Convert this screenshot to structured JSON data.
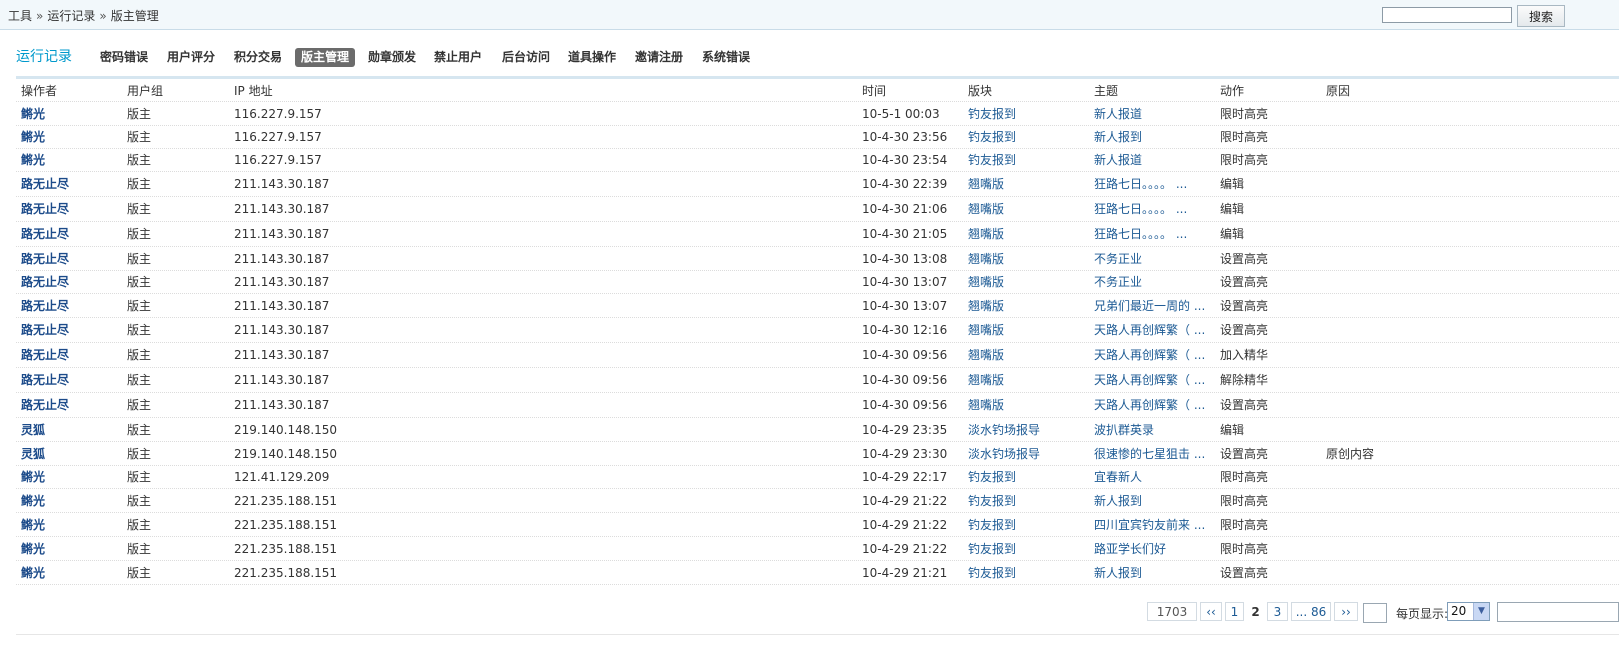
{
  "breadcrumb": {
    "items": [
      "工具",
      "运行记录",
      "版主管理"
    ],
    "separator": "»"
  },
  "search": {
    "value": "",
    "button_label": "搜索"
  },
  "tabs": {
    "title": "运行记录",
    "items": [
      {
        "label": "密码错误",
        "active": false
      },
      {
        "label": "用户评分",
        "active": false
      },
      {
        "label": "积分交易",
        "active": false
      },
      {
        "label": "版主管理",
        "active": true
      },
      {
        "label": "勋章颁发",
        "active": false
      },
      {
        "label": "禁止用户",
        "active": false
      },
      {
        "label": "后台访问",
        "active": false
      },
      {
        "label": "道具操作",
        "active": false
      },
      {
        "label": "邀请注册",
        "active": false
      },
      {
        "label": "系统错误",
        "active": false
      }
    ]
  },
  "table": {
    "headers": {
      "operator": "操作者",
      "group": "用户组",
      "ip": "IP 地址",
      "time": "时间",
      "forum": "版块",
      "subject": "主题",
      "action": "动作",
      "reason": "原因"
    },
    "rows": [
      {
        "operator": "鳉光",
        "group": "版主",
        "ip": "116.227.9.157",
        "time": "10-5-1 00:03",
        "forum": "钓友报到",
        "subject": "新人报道",
        "action": "限时高亮",
        "reason": ""
      },
      {
        "operator": "鳉光",
        "group": "版主",
        "ip": "116.227.9.157",
        "time": "10-4-30 23:56",
        "forum": "钓友报到",
        "subject": "新人报到",
        "action": "限时高亮",
        "reason": ""
      },
      {
        "operator": "鳉光",
        "group": "版主",
        "ip": "116.227.9.157",
        "time": "10-4-30 23:54",
        "forum": "钓友报到",
        "subject": "新人报道",
        "action": "限时高亮",
        "reason": ""
      },
      {
        "operator": "路无止尽",
        "group": "版主",
        "ip": "211.143.30.187",
        "time": "10-4-30 22:39",
        "forum": "翘嘴版",
        "subject": "狂路七日。。。。 ...",
        "action": "编辑",
        "reason": ""
      },
      {
        "operator": "路无止尽",
        "group": "版主",
        "ip": "211.143.30.187",
        "time": "10-4-30 21:06",
        "forum": "翘嘴版",
        "subject": "狂路七日。。。。 ...",
        "action": "编辑",
        "reason": ""
      },
      {
        "operator": "路无止尽",
        "group": "版主",
        "ip": "211.143.30.187",
        "time": "10-4-30 21:05",
        "forum": "翘嘴版",
        "subject": "狂路七日。。。。 ...",
        "action": "编辑",
        "reason": ""
      },
      {
        "operator": "路无止尽",
        "group": "版主",
        "ip": "211.143.30.187",
        "time": "10-4-30 13:08",
        "forum": "翘嘴版",
        "subject": "不务正业",
        "action": "设置高亮",
        "reason": ""
      },
      {
        "operator": "路无止尽",
        "group": "版主",
        "ip": "211.143.30.187",
        "time": "10-4-30 13:07",
        "forum": "翘嘴版",
        "subject": "不务正业",
        "action": "设置高亮",
        "reason": ""
      },
      {
        "operator": "路无止尽",
        "group": "版主",
        "ip": "211.143.30.187",
        "time": "10-4-30 13:07",
        "forum": "翘嘴版",
        "subject": "兄弟们最近一周的 ...",
        "action": "设置高亮",
        "reason": ""
      },
      {
        "operator": "路无止尽",
        "group": "版主",
        "ip": "211.143.30.187",
        "time": "10-4-30 12:16",
        "forum": "翘嘴版",
        "subject": "天路人再创辉繁（ ...",
        "action": "设置高亮",
        "reason": ""
      },
      {
        "operator": "路无止尽",
        "group": "版主",
        "ip": "211.143.30.187",
        "time": "10-4-30 09:56",
        "forum": "翘嘴版",
        "subject": "天路人再创辉繁（ ...",
        "action": "加入精华",
        "reason": ""
      },
      {
        "operator": "路无止尽",
        "group": "版主",
        "ip": "211.143.30.187",
        "time": "10-4-30 09:56",
        "forum": "翘嘴版",
        "subject": "天路人再创辉繁（ ...",
        "action": "解除精华",
        "reason": ""
      },
      {
        "operator": "路无止尽",
        "group": "版主",
        "ip": "211.143.30.187",
        "time": "10-4-30 09:56",
        "forum": "翘嘴版",
        "subject": "天路人再创辉繁（ ...",
        "action": "设置高亮",
        "reason": ""
      },
      {
        "operator": "灵狐",
        "group": "版主",
        "ip": "219.140.148.150",
        "time": "10-4-29 23:35",
        "forum": "淡水钓场报导",
        "subject": "波扒群英录",
        "action": "编辑",
        "reason": ""
      },
      {
        "operator": "灵狐",
        "group": "版主",
        "ip": "219.140.148.150",
        "time": "10-4-29 23:30",
        "forum": "淡水钓场报导",
        "subject": "很速惨的七星狙击 ...",
        "action": "设置高亮",
        "reason": "原创内容"
      },
      {
        "operator": "鳉光",
        "group": "版主",
        "ip": "121.41.129.209",
        "time": "10-4-29 22:17",
        "forum": "钓友报到",
        "subject": "宜春新人",
        "action": "限时高亮",
        "reason": ""
      },
      {
        "operator": "鳉光",
        "group": "版主",
        "ip": "221.235.188.151",
        "time": "10-4-29 21:22",
        "forum": "钓友报到",
        "subject": "新人报到",
        "action": "限时高亮",
        "reason": ""
      },
      {
        "operator": "鳉光",
        "group": "版主",
        "ip": "221.235.188.151",
        "time": "10-4-29 21:22",
        "forum": "钓友报到",
        "subject": "四川宜宾钓友前来 ...",
        "action": "限时高亮",
        "reason": ""
      },
      {
        "operator": "鳉光",
        "group": "版主",
        "ip": "221.235.188.151",
        "time": "10-4-29 21:22",
        "forum": "钓友报到",
        "subject": "路亚学长们好",
        "action": "限时高亮",
        "reason": ""
      },
      {
        "operator": "鳉光",
        "group": "版主",
        "ip": "221.235.188.151",
        "time": "10-4-29 21:21",
        "forum": "钓友报到",
        "subject": "新人报到",
        "action": "设置高亮",
        "reason": ""
      }
    ]
  },
  "pager": {
    "total": "1703",
    "prev": "‹‹",
    "pages": [
      "1",
      "2",
      "3",
      "... 86"
    ],
    "current": "2",
    "next": "››",
    "per_page_label": "每页显示:",
    "per_page_value": "20"
  },
  "colors": {
    "link": "#1c5a94",
    "operator": "#1c4b8a",
    "tab_title": "#0099cc",
    "active_tab_bg": "#6b6b6b"
  }
}
